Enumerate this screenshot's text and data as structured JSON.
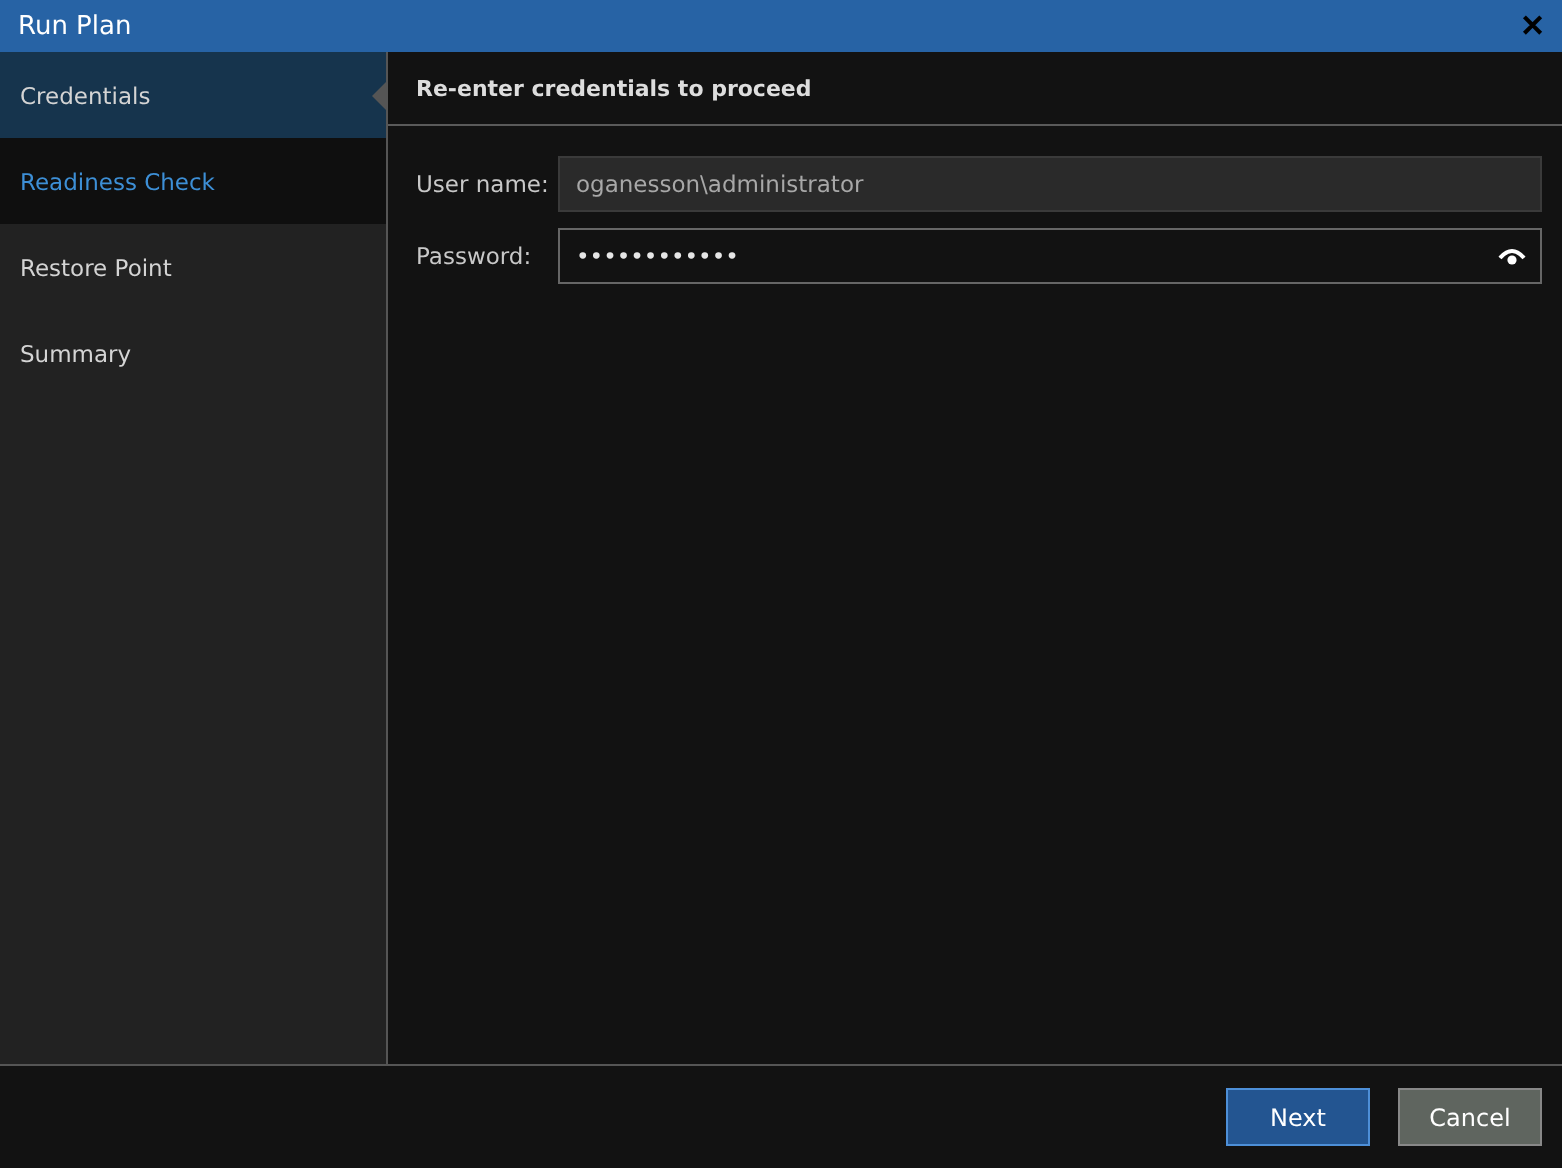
{
  "window": {
    "title": "Run Plan",
    "close": "✕"
  },
  "steps": [
    {
      "label": "Credentials",
      "selected": true,
      "hovered": false
    },
    {
      "label": "Readiness Check",
      "selected": false,
      "hovered": true
    },
    {
      "label": "Restore Point",
      "selected": false,
      "hovered": false
    },
    {
      "label": "Summary",
      "selected": false,
      "hovered": false
    }
  ],
  "heading": "Re-enter credentials to proceed",
  "fields": [
    {
      "label": "User name:",
      "value": "oganesson\\administrator",
      "disabled": true,
      "kind": "text"
    },
    {
      "label": "Password:",
      "value": "••••••••••••",
      "disabled": false,
      "kind": "password"
    }
  ],
  "buttons": [
    {
      "label": "Next",
      "primary": true
    },
    {
      "label": "Cancel",
      "primary": false
    }
  ]
}
